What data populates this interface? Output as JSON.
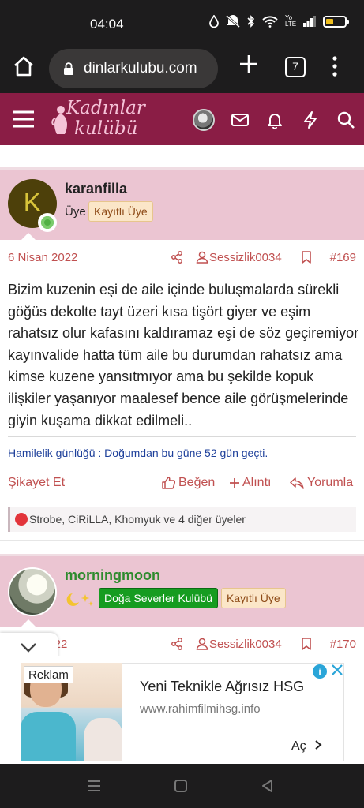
{
  "status_bar": {
    "time": "04:04",
    "net_label": "Yo LTE"
  },
  "browser": {
    "url": "dinlarkulubu.com",
    "tab_count": "7"
  },
  "site": {
    "logo_line1": "Kadınlar",
    "logo_line2": "kulübü"
  },
  "post1": {
    "author": "karanfilla",
    "author_initial": "K",
    "role": "Üye",
    "badge": "Kayıtlı Üye",
    "date": "6 Nisan 2022",
    "meta_user": "Sessizlik0034",
    "number": "#169",
    "body": "Bizim kuzenin eşi de aile içinde buluşmalarda sürekli göğüs dekolte tayt üzeri kısa tişört giyer ve eşim rahatsız olur kafasını kaldıramaz eşi de söz geçiremiyor kayınvalide hatta tüm aile bu durumdan rahatsız ama kimse kuzene yansıtmıyor ama bu şekilde kopuk ilişkiler yaşanıyor maalesef bence aile görüşmelerinde giyin kuşama dikkat edilmeli..",
    "signature": "Hamilelik günlüğü : Doğumdan bu güne 52 gün geçti.",
    "actions": {
      "report": "Şikayet Et",
      "like": "Beğen",
      "quote": "Alıntı",
      "reply": "Yorumla"
    },
    "reactions": "Strobe, CiRiLLA, Khomyuk ve 4 diğer üyeler"
  },
  "post2": {
    "author": "morningmoon",
    "badge_club": "Doğa Severler Kulübü",
    "badge": "Kayıtlı Üye",
    "date": "2022",
    "meta_user": "Sessizlik0034",
    "number": "#170"
  },
  "ad": {
    "label": "Reklam",
    "title": "Yeni Teknikle Ağrısız HSG",
    "url": "www.rahimfilmihsg.info",
    "cta": "Aç"
  },
  "colors": {
    "header": "#8a1d45",
    "post_head": "#ebc5d2",
    "accent_text": "#c05050",
    "signature": "#1d3f9a",
    "club_badge": "#169c20"
  }
}
